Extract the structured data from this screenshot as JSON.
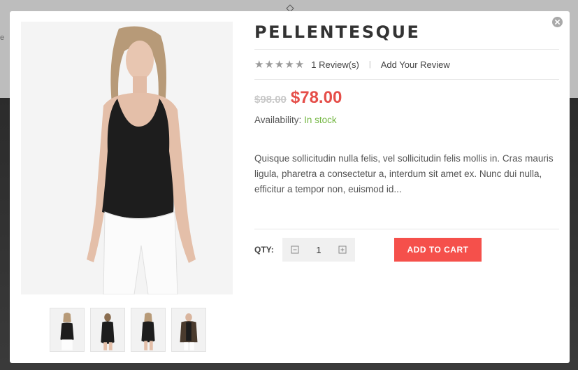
{
  "backdrop": {
    "hint": "e"
  },
  "product": {
    "title": "PELLENTESQUE",
    "rating_stars": 5,
    "reviews_label": "1 Review(s)",
    "separator": "|",
    "add_review_label": "Add Your Review",
    "old_price": "$98.00",
    "new_price": "$78.00",
    "availability_label": "Availability:",
    "availability_value": "In stock",
    "description": "Quisque sollicitudin nulla felis, vel sollicitudin felis mollis in. Cras mauris ligula, pharetra a consectetur a, interdum sit amet ex. Nunc dui nulla, efficitur a tempor non, euismod id..."
  },
  "cart": {
    "qty_label": "QTY:",
    "qty_value": "1",
    "add_to_cart_label": "ADD TO CART"
  },
  "gallery": {
    "thumbnails": [
      "thumb-1",
      "thumb-2",
      "thumb-3",
      "thumb-4"
    ]
  },
  "icons": {
    "close": "close-icon",
    "star": "star-icon",
    "minus": "minus-icon",
    "plus": "plus-icon"
  },
  "colors": {
    "accent": "#f5504b",
    "new_price": "#e54e49",
    "in_stock": "#74b743",
    "old_price": "#c8c8c8"
  }
}
